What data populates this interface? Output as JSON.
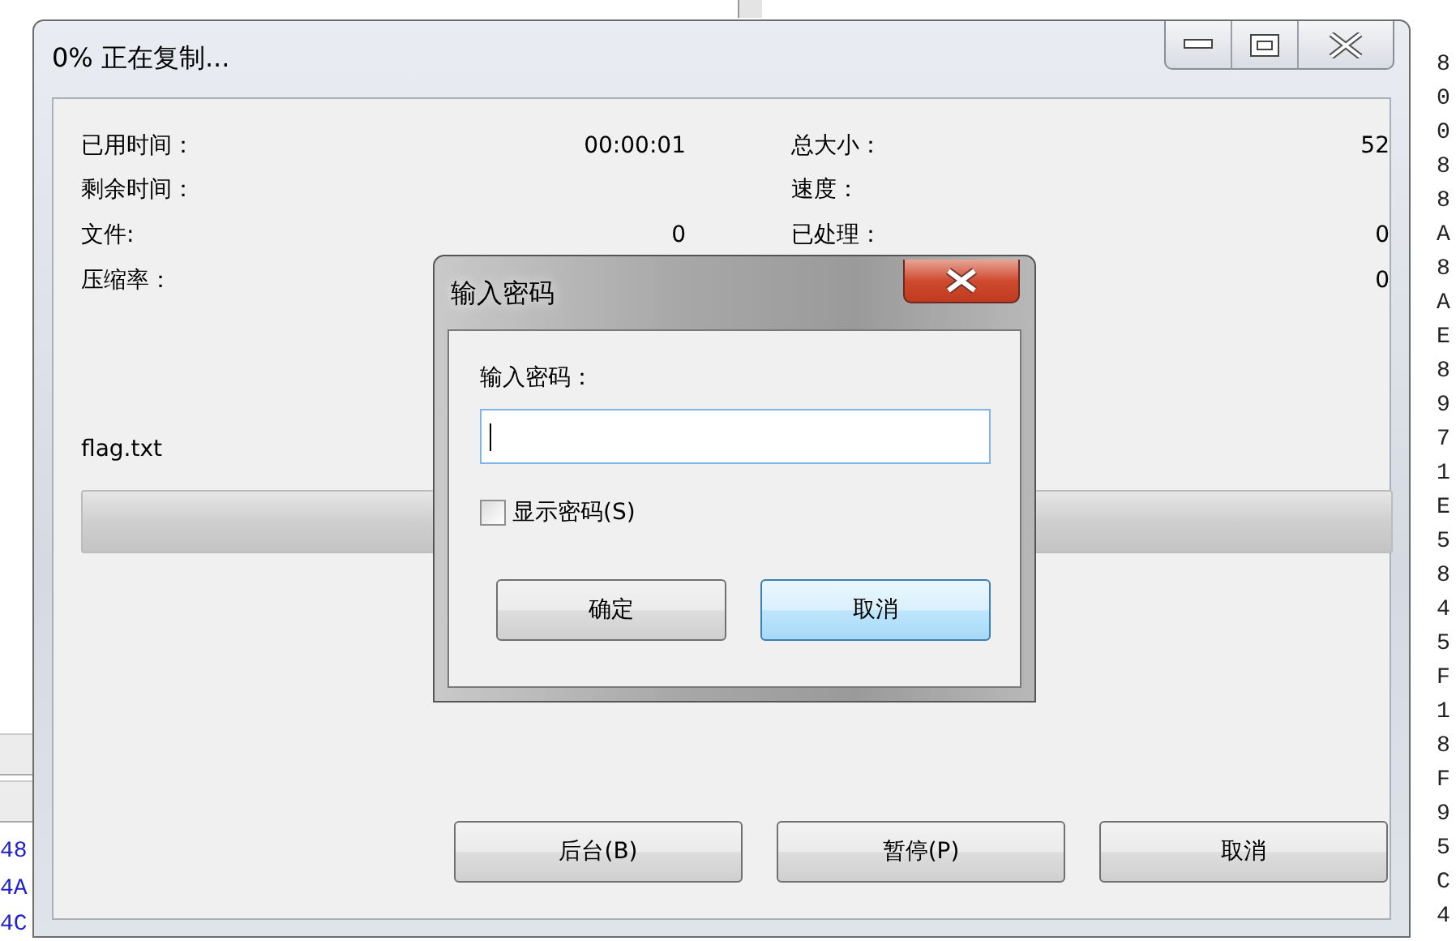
{
  "backdrop": {
    "left_lines": [
      "48",
      "4A",
      "4C"
    ],
    "right_column": [
      "8",
      "0",
      "0",
      "8",
      "8",
      "A",
      "8",
      "A",
      "E",
      "8",
      "9",
      "7",
      "1",
      "E",
      "5",
      "8",
      "4",
      "5",
      "F",
      "1",
      "8",
      "F",
      "9",
      "5",
      "C",
      "4"
    ]
  },
  "window": {
    "title": "0% 正在复制...",
    "stats_left": [
      {
        "label": "已用时间：",
        "value": "00:00:01"
      },
      {
        "label": "剩余时间："
      },
      {
        "label": "文件:",
        "value": "0"
      },
      {
        "label": "压缩率："
      }
    ],
    "stats_right": [
      {
        "label": "总大小：",
        "value": "52"
      },
      {
        "label": "速度："
      },
      {
        "label": "已处理：",
        "value": "0"
      },
      {
        "value": "0"
      }
    ],
    "file_name": "flag.txt",
    "progress": {
      "level": 0
    },
    "buttons": [
      "后台(B)",
      "暂停(P)",
      "取消"
    ]
  },
  "dialog": {
    "title": "输入密码",
    "field_label": "输入密码：",
    "show_password": {
      "label": "显示密码(S)",
      "checked": false
    },
    "buttons": [
      {
        "label": "确定",
        "highlighted": false
      },
      {
        "label": "取消",
        "highlighted": true
      }
    ]
  }
}
